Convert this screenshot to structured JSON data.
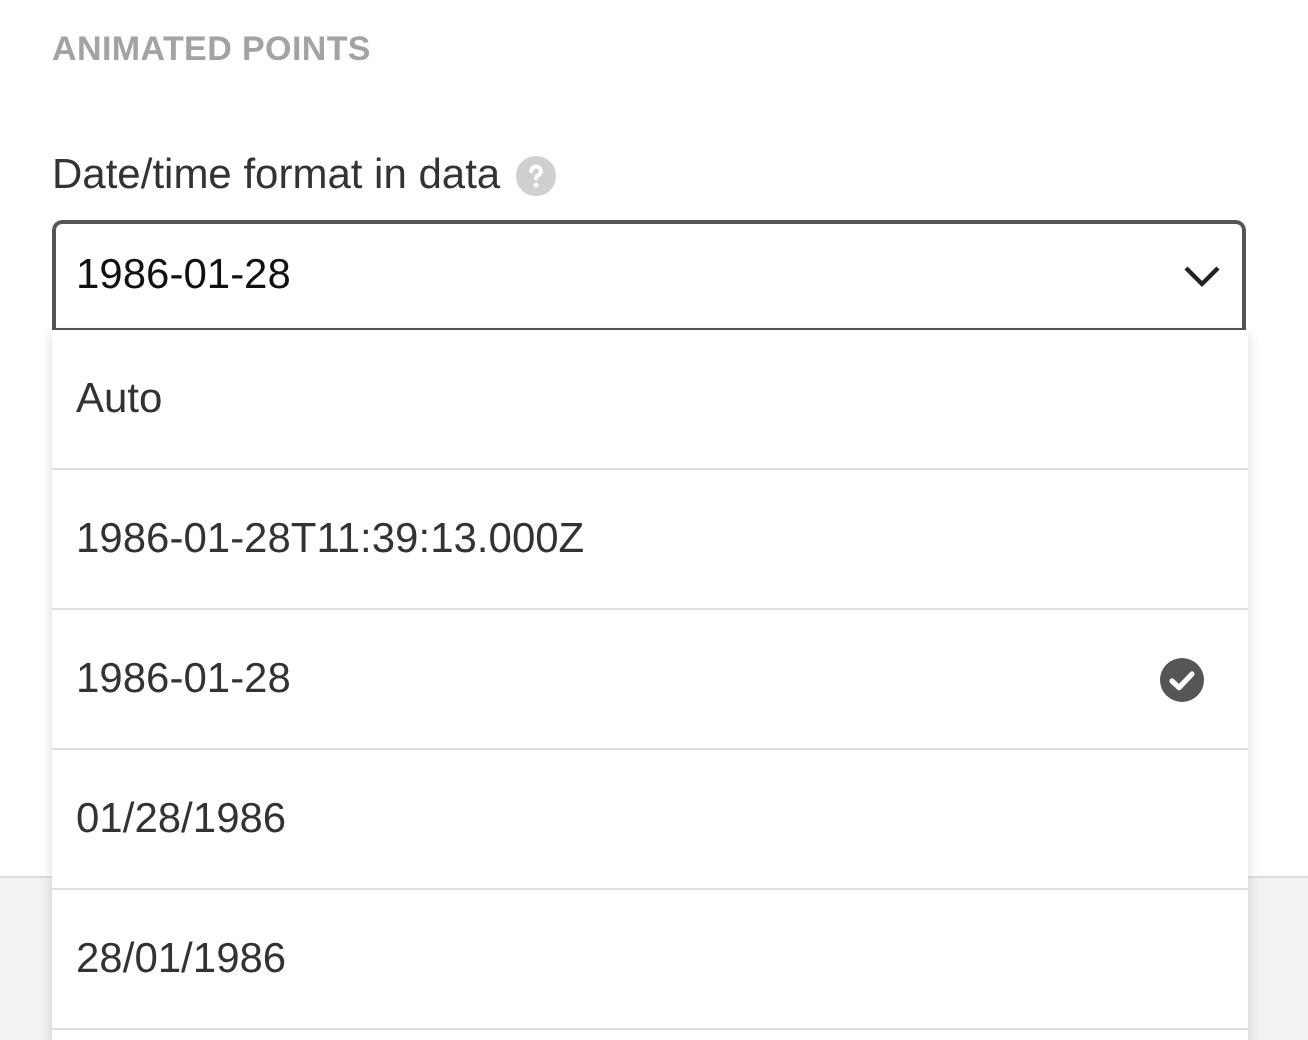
{
  "section_title": "ANIMATED POINTS",
  "field": {
    "label": "Date/time format in data",
    "value": "1986-01-28",
    "expanded": true
  },
  "options": [
    {
      "label": "Auto",
      "selected": false
    },
    {
      "label": "1986-01-28T11:39:13.000Z",
      "selected": false
    },
    {
      "label": "1986-01-28",
      "selected": true
    },
    {
      "label": "01/28/1986",
      "selected": false
    },
    {
      "label": "28/01/1986",
      "selected": false
    }
  ]
}
